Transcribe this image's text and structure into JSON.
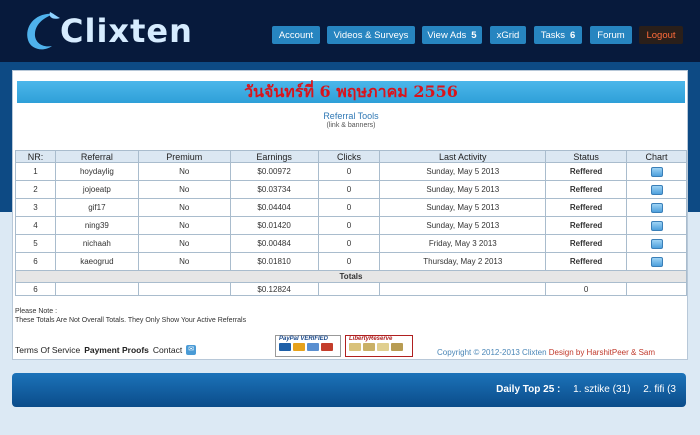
{
  "brand": {
    "name": "Clixten"
  },
  "nav": [
    {
      "label": "Account",
      "badge": ""
    },
    {
      "label": "Videos & Surveys",
      "badge": ""
    },
    {
      "label": "View Ads",
      "badge": "5"
    },
    {
      "label": "xGrid",
      "badge": ""
    },
    {
      "label": "Tasks",
      "badge": "6"
    },
    {
      "label": "Forum",
      "badge": ""
    },
    {
      "label": "Logout",
      "badge": ""
    }
  ],
  "date_banner": "วันจันทร์ที่ 6 พฤษภาคม 2556",
  "tools": {
    "title": "Referral Tools",
    "subtitle": "(link & banners)"
  },
  "table": {
    "headers": [
      "NR:",
      "Referral",
      "Premium",
      "Earnings",
      "Clicks",
      "Last Activity",
      "Status",
      "Chart"
    ],
    "rows": [
      [
        "1",
        "hoydaylig",
        "No",
        "$0.00972",
        "0",
        "Sunday, May 5 2013",
        "Reffered"
      ],
      [
        "2",
        "jojoeatp",
        "No",
        "$0.03734",
        "0",
        "Sunday, May 5 2013",
        "Reffered"
      ],
      [
        "3",
        "gif17",
        "No",
        "$0.04404",
        "0",
        "Sunday, May 5 2013",
        "Reffered"
      ],
      [
        "4",
        "ning39",
        "No",
        "$0.01420",
        "0",
        "Sunday, May 5 2013",
        "Reffered"
      ],
      [
        "5",
        "nichaah",
        "No",
        "$0.00484",
        "0",
        "Friday, May 3 2013",
        "Reffered"
      ],
      [
        "6",
        "kaeogrud",
        "No",
        "$0.01810",
        "0",
        "Thursday, May 2 2013",
        "Reffered"
      ]
    ],
    "totals_label": "Totals",
    "totals": {
      "count": "6",
      "earnings": "$0.12824",
      "status": "0"
    }
  },
  "note": {
    "line1": "Please Note :",
    "line2": "These Totals Are Not Overall Totals. They Only Show Your Active Referrals"
  },
  "footer": {
    "terms": "Terms Of Service",
    "proofs": "Payment Proofs",
    "contact": "Contact",
    "paypal": "PayPal VERIFIED",
    "liberty": "LibertyReserve",
    "copyright": "Copyright © 2012-2013 Clixten",
    "design": "Design by HarshitPeer & Sam"
  },
  "daily_top": {
    "label": "Daily Top 25 :",
    "items": [
      "1. sztike (31)",
      "2. fifi (3"
    ]
  },
  "colors": {
    "header_bg": "#071a3c",
    "nav_button": "#2785c0",
    "date_text": "#d8141c",
    "accent_blue": "#2f78b5"
  }
}
